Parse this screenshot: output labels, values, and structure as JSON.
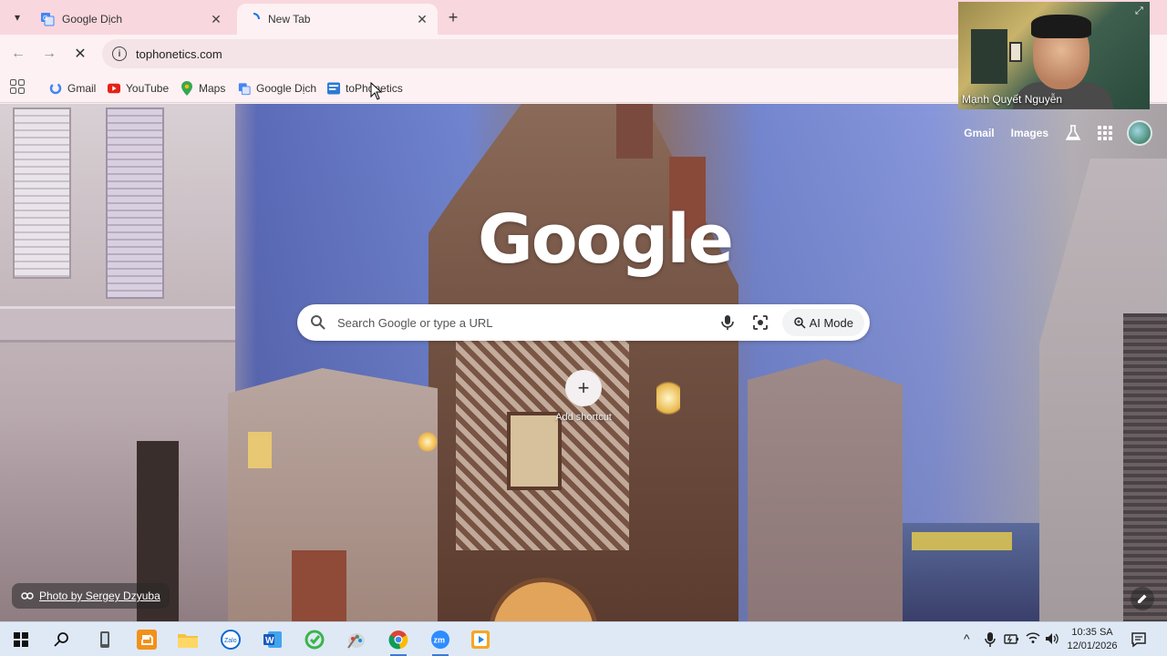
{
  "browser": {
    "tabs": [
      {
        "title": "Google Dịch",
        "icon": "google-translate-icon",
        "active": false
      },
      {
        "title": "New Tab",
        "icon": "loading-icon",
        "active": true
      }
    ],
    "url": "tophonetics.com",
    "bookmarks": [
      {
        "label": "Gmail",
        "icon": "google-g-icon"
      },
      {
        "label": "YouTube",
        "icon": "youtube-icon"
      },
      {
        "label": "Maps",
        "icon": "maps-pin-icon"
      },
      {
        "label": "Google Dịch",
        "icon": "google-translate-icon"
      },
      {
        "label": "toPhonetics",
        "icon": "tophonetics-icon"
      }
    ]
  },
  "newtab": {
    "links": {
      "gmail": "Gmail",
      "images": "Images"
    },
    "logo": "Google",
    "search_placeholder": "Search Google or type a URL",
    "ai_mode": "AI Mode",
    "shortcut_label": "Add shortcut",
    "photo_credit": "Photo by Sergey Dzyuba"
  },
  "video_overlay": {
    "name": "Mạnh Quyết Nguyễn"
  },
  "taskbar": {
    "apps": [
      "start-icon",
      "search-icon",
      "phone-icon",
      "office-icon",
      "file-explorer-icon",
      "zalo-icon",
      "word-icon",
      "app-green-icon",
      "paint-icon",
      "chrome-icon",
      "zoom-icon",
      "media-player-icon"
    ],
    "clock_time": "10:35 SA",
    "clock_date": "12/01/2026"
  },
  "colors": {
    "tabstrip": "#f9d7de",
    "toolbar": "#fdf1f3",
    "taskbar": "#dfe9f6"
  }
}
